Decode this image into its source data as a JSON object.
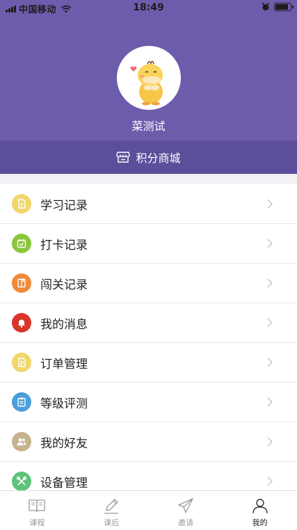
{
  "status_bar": {
    "carrier": "中国移动",
    "time": "18:49",
    "battery_level": 0.85
  },
  "profile": {
    "avatar_icon": "duck-avatar-icon",
    "username": "菜测试"
  },
  "mall": {
    "icon": "store-icon",
    "label": "积分商城"
  },
  "menu": {
    "items": [
      {
        "label": "学习记录",
        "icon": "document-icon",
        "color": "#f1d66b"
      },
      {
        "label": "打卡记录",
        "icon": "calendar-check-icon",
        "color": "#8cc63e"
      },
      {
        "label": "闯关记录",
        "icon": "book-icon",
        "color": "#ef8a3a"
      },
      {
        "label": "我的消息",
        "icon": "bell-icon",
        "color": "#d9352b"
      },
      {
        "label": "订单管理",
        "icon": "receipt-icon",
        "color": "#f1d66b"
      },
      {
        "label": "等级评测",
        "icon": "clipboard-icon",
        "color": "#4a9fd8"
      },
      {
        "label": "我的好友",
        "icon": "friends-icon",
        "color": "#c7b28e"
      },
      {
        "label": "设备管理",
        "icon": "tools-icon",
        "color": "#5ec27a"
      }
    ]
  },
  "tabbar": {
    "tabs": [
      {
        "label": "课程",
        "icon": "open-book-icon"
      },
      {
        "label": "课后",
        "icon": "pencil-icon"
      },
      {
        "label": "邀请",
        "icon": "paper-plane-icon"
      },
      {
        "label": "我的",
        "icon": "user-icon"
      }
    ],
    "active": "我的"
  },
  "colors": {
    "header": "#6d5cac",
    "mall_bar": "#5c4e9a"
  }
}
